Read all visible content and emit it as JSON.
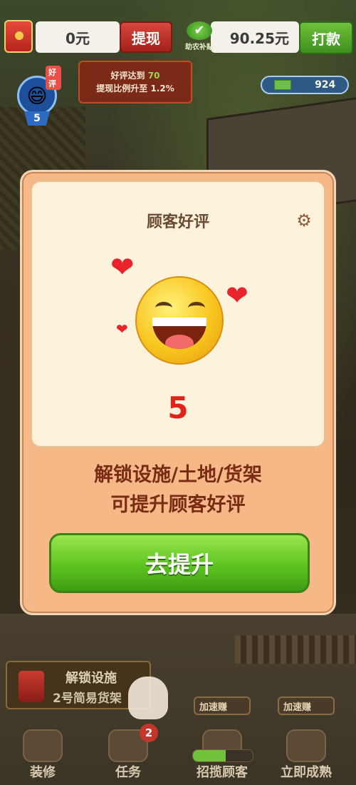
{
  "top": {
    "balance": "0元",
    "withdraw_label": "提现",
    "subsidy_label": "助农补贴",
    "subsidy_amount": "90.25元",
    "payout_label": "打款"
  },
  "tooltip": {
    "line1_prefix": "好评达到",
    "line1_value": "70",
    "line2": "提现比例升至 1.2%"
  },
  "rating_badge": {
    "tag": "好评",
    "value": "5"
  },
  "cash": {
    "amount": "924"
  },
  "modal": {
    "title": "顾客好评",
    "score": "5",
    "message_line1": "解锁设施/土地/货架",
    "message_line2": "可提升顾客好评",
    "cta_label": "去提升"
  },
  "unlock_task": {
    "line1": "解锁设施",
    "line2": "2号简易货架"
  },
  "boosts": [
    "加速赚",
    "加速赚"
  ],
  "nav": {
    "items": [
      "装修",
      "任务",
      "招揽顾客",
      "立即成熟"
    ],
    "task_badge": "2",
    "progress": 0.55
  },
  "colors": {
    "accent_green": "#5cc41f",
    "score_red": "#e2231a",
    "modal_bg": "#f6b887"
  }
}
